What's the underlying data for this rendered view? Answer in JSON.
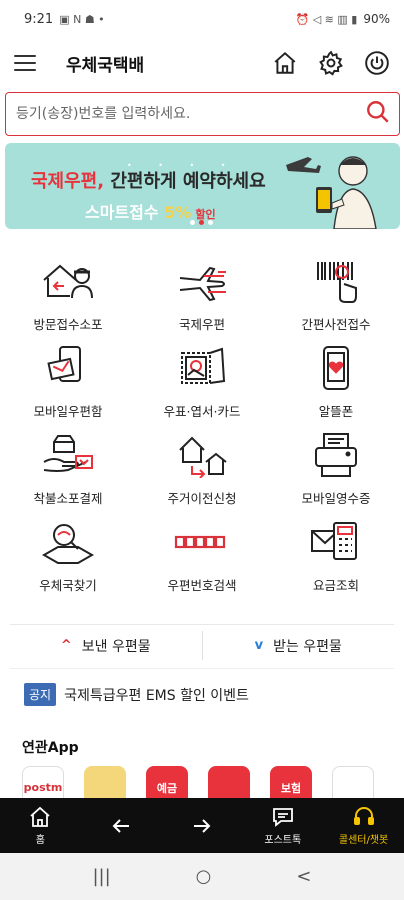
{
  "status_bar": {
    "time": "9:21",
    "left_icons": "▣ N ☗ •",
    "right_icons": "⏰ ◁ ≋ ▥ ▮",
    "battery": "90%"
  },
  "app": {
    "title": "우체국택배"
  },
  "search": {
    "placeholder": "등기(송장)번호를 입력하세요."
  },
  "banner": {
    "line1_red": "국제우편,",
    "line1_rest": "간편하게 예약하세요",
    "line2_main": "스마트접수 ",
    "line2_pct": "5%",
    "line2_small": "할인",
    "dots": "• • • •"
  },
  "services": [
    {
      "label": "방문접수소포"
    },
    {
      "label": "국제우편"
    },
    {
      "label": "간편사전접수"
    },
    {
      "label": "모바일우편함"
    },
    {
      "label": "우표·엽서·카드"
    },
    {
      "label": "알뜰폰"
    },
    {
      "label": "착불소포결제"
    },
    {
      "label": "주거이전신청"
    },
    {
      "label": "모바일영수증"
    },
    {
      "label": "우체국찾기"
    },
    {
      "label": "우편번호검색"
    },
    {
      "label": "요금조회"
    }
  ],
  "mail_toggle": {
    "sent": "보낸 우편물",
    "received": "받는 우편물",
    "up_caret": "^",
    "down_caret": "v"
  },
  "notice": {
    "badge": "공지",
    "text": "국제특급우편 EMS 할인 이벤트"
  },
  "related": {
    "title": "연관App",
    "apps": [
      {
        "text": "postm",
        "color": "#ffffff",
        "fg": "#d8323a"
      },
      {
        "text": "",
        "color": "#f4d77a",
        "fg": "#d8323a"
      },
      {
        "text": "예금",
        "color": "#e8333d",
        "fg": "#ffffff"
      },
      {
        "text": "",
        "color": "#e8333d",
        "fg": "#ffffff"
      },
      {
        "text": "보험",
        "color": "#e8333d",
        "fg": "#ffffff"
      },
      {
        "text": "",
        "color": "#ffffff",
        "fg": "#d8323a"
      }
    ]
  },
  "bottom_nav": {
    "home": "홈",
    "back": "",
    "forward": "",
    "posttalk": "포스트톡",
    "callcenter": "콜센터/챗봇"
  },
  "system_nav": {
    "recents": "|||",
    "home": "○",
    "back": "<"
  }
}
